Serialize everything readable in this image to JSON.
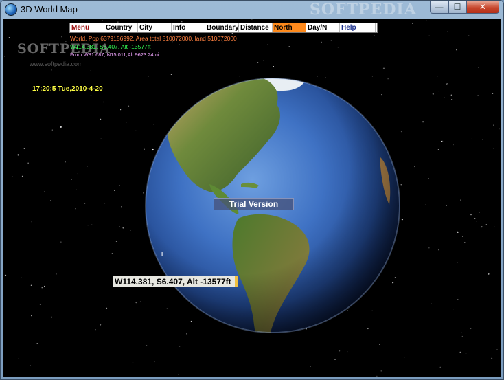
{
  "window": {
    "title": "3D World Map",
    "watermark": "SOFTPEDIA",
    "controls": {
      "minimize": "—",
      "maximize": "☐",
      "close": "✕"
    }
  },
  "menu": [
    {
      "label": "Menu",
      "name": "menu"
    },
    {
      "label": "Country",
      "name": "country"
    },
    {
      "label": "City",
      "name": "city"
    },
    {
      "label": "Info",
      "name": "info"
    },
    {
      "label": "Boundary",
      "name": "boundary"
    },
    {
      "label": "Distance",
      "name": "distance"
    },
    {
      "label": "North Lock",
      "name": "north-lock"
    },
    {
      "label": "Day/N",
      "name": "day-night"
    },
    {
      "label": "Help",
      "name": "help"
    }
  ],
  "info": {
    "world": "World, Pop  6379156992, Area total 510072000, land 510072000",
    "coordinates": "W114.381, S6.407, Alt -13577ft",
    "from": "From W81.687, N15.011,Alt 9623.24mi."
  },
  "watermark": {
    "brand": "SOFTPEDIA",
    "url": "www.softpedia.com"
  },
  "datetime": "17:20:5 Tue,2010-4-20",
  "trial": "Trial Version",
  "tooltip": "W114.381, S6.407, Alt -13577ft",
  "colors": {
    "menu_highlight": "#ff8a1c",
    "info_world": "#ff8040",
    "info_coord": "#33ff55",
    "datetime": "#ffff44"
  }
}
